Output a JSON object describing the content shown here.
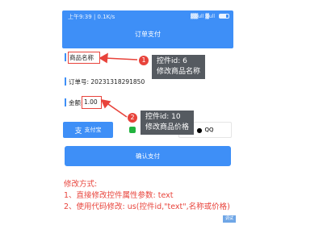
{
  "status_bar": {
    "time_speed": "上午9:39 | 0.1K/s",
    "signal": "▓▓ull ▓ull"
  },
  "header": {
    "title": "订单支付"
  },
  "fields": {
    "product_label": "商品名称",
    "order_label": "订单号: 20231318291850",
    "amount_label": "金额:",
    "amount_value": "1.00"
  },
  "callouts": {
    "one": {
      "badge": "1",
      "line1": "控件id: 6",
      "line2": "修改商品名称"
    },
    "two": {
      "badge": "2",
      "line1": "控件id: 10",
      "line2": "修改商品价格"
    }
  },
  "payment": {
    "alipay_label": "支付宝",
    "qq_label": "QQ",
    "confirm_label": "确认支付"
  },
  "notes": {
    "heading": "修改方式:",
    "line1": "1、直接修改控件属性参数: text",
    "line2": "2、使用代码修改: us(控件id,\"text\",名称或价格)"
  },
  "debug_label": "调试",
  "colors": {
    "accent": "#3e8ff7",
    "annotation": "#e8433b",
    "callout_bg": "#555a60",
    "wechat": "#22b33f"
  }
}
